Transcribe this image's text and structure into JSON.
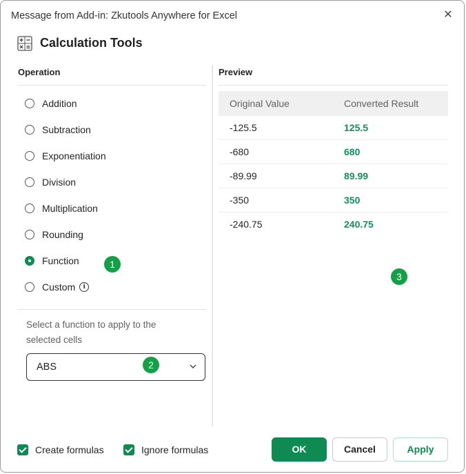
{
  "window": {
    "title": "Message from Add-in: Zkutools Anywhere for Excel",
    "close_glyph": "✕"
  },
  "header": {
    "icon": "calculator-icon",
    "title": "Calculation Tools"
  },
  "operation": {
    "section_title": "Operation",
    "options": [
      {
        "label": "Addition",
        "selected": false
      },
      {
        "label": "Subtraction",
        "selected": false
      },
      {
        "label": "Exponentiation",
        "selected": false
      },
      {
        "label": "Division",
        "selected": false
      },
      {
        "label": "Multiplication",
        "selected": false
      },
      {
        "label": "Rounding",
        "selected": false
      },
      {
        "label": "Function",
        "selected": true
      },
      {
        "label": "Custom",
        "selected": false,
        "info_icon": "info-icon"
      }
    ],
    "hint": "Select a function to apply to the selected cells",
    "function_select": {
      "value": "ABS"
    }
  },
  "preview": {
    "section_title": "Preview",
    "columns": [
      "Original Value",
      "Converted Result"
    ],
    "rows": [
      {
        "original": "-125.5",
        "converted": "125.5"
      },
      {
        "original": "-680",
        "converted": "680"
      },
      {
        "original": "-89.99",
        "converted": "89.99"
      },
      {
        "original": "-350",
        "converted": "350"
      },
      {
        "original": "-240.75",
        "converted": "240.75"
      }
    ]
  },
  "badges": [
    "1",
    "2",
    "3"
  ],
  "footer": {
    "create_formulas": {
      "label": "Create formulas",
      "checked": true
    },
    "ignore_formulas": {
      "label": "Ignore formulas",
      "checked": true
    },
    "ok_label": "OK",
    "cancel_label": "Cancel",
    "apply_label": "Apply"
  },
  "colors": {
    "accent": "#0f8a52",
    "badge": "#14a047",
    "result_text": "#11905a"
  }
}
